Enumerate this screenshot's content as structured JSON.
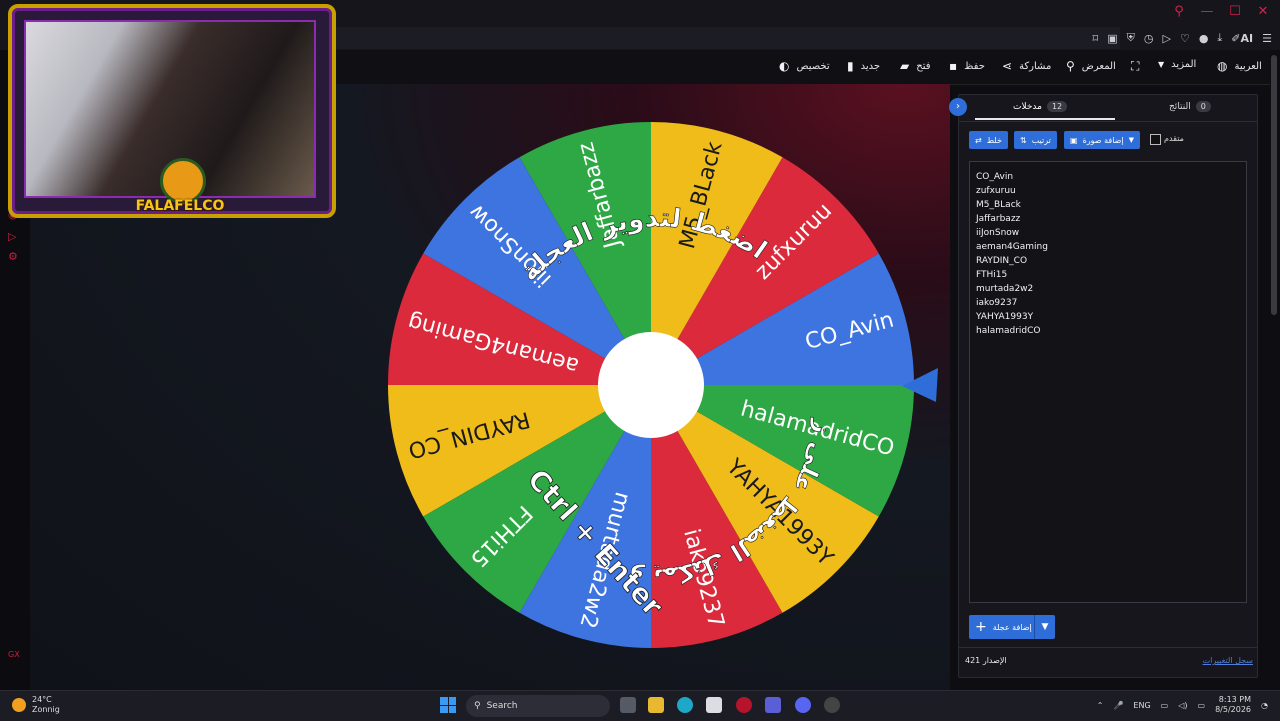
{
  "browser": {
    "window_controls": [
      "⚲",
      "—",
      "☐",
      "✕"
    ],
    "extension_ai_label": "AI"
  },
  "toolbar": {
    "language": "العربية",
    "more": "المزيد",
    "gallery": "المعرض",
    "share": "مشاركة",
    "save": "حفظ",
    "open": "فتح",
    "new": "جديد",
    "customize": "تخصيص"
  },
  "webcam": {
    "logo_text": "FALAFELCO"
  },
  "wheel": {
    "segments": [
      {
        "label": "CO_Avin",
        "color": "#3e74e0"
      },
      {
        "label": "zufxuruu",
        "color": "#db2a3c"
      },
      {
        "label": "M5_BLack",
        "color": "#f0bc1a"
      },
      {
        "label": "Jaffarbazz",
        "color": "#2ea844"
      },
      {
        "label": "iiJonSnow",
        "color": "#3e74e0"
      },
      {
        "label": "aeman4Gaming",
        "color": "#db2a3c"
      },
      {
        "label": "RAYDIN_CO",
        "color": "#f0bc1a"
      },
      {
        "label": "FTHi15",
        "color": "#2ea844"
      },
      {
        "label": "murtada2w2",
        "color": "#3e74e0"
      },
      {
        "label": "iako9237",
        "color": "#db2a3c"
      },
      {
        "label": "YAHYA1993Y",
        "color": "#f0bc1a"
      },
      {
        "label": "halamadridCO",
        "color": "#2ea844"
      }
    ],
    "instruction_top": "اضغط لتدوير العجلة",
    "instruction_bottom": "أو يمكنك الضغط على زر",
    "shortcut": "Ctrl + Enter"
  },
  "panel": {
    "tab_entries": "مدخلات",
    "tab_entries_count": "12",
    "tab_results": "النتائج",
    "tab_results_count": "0",
    "shuffle_label": "خلط",
    "sort_label": "ترتيب",
    "add_image_label": "إضافة صورة",
    "advanced_label": "متقدم",
    "entries": [
      "CO_Avin",
      "zufxuruu",
      "M5_BLack",
      "Jaffarbazz",
      "iiJonSnow",
      "aeman4Gaming",
      "RAYDIN_CO",
      "FTHi15",
      "murtada2w2",
      "iako9237",
      "YAHYA1993Y",
      "halamadridCO"
    ],
    "add_wheel_label": "إضافة عجلة",
    "version": "الإصدار 421",
    "changelog": "سجل التغييرات"
  },
  "taskbar": {
    "temp": "24°C",
    "weather": "Zonnig",
    "search": "Search",
    "lang": "ENG",
    "time": "8:13 PM",
    "date": "8/5/2026"
  }
}
